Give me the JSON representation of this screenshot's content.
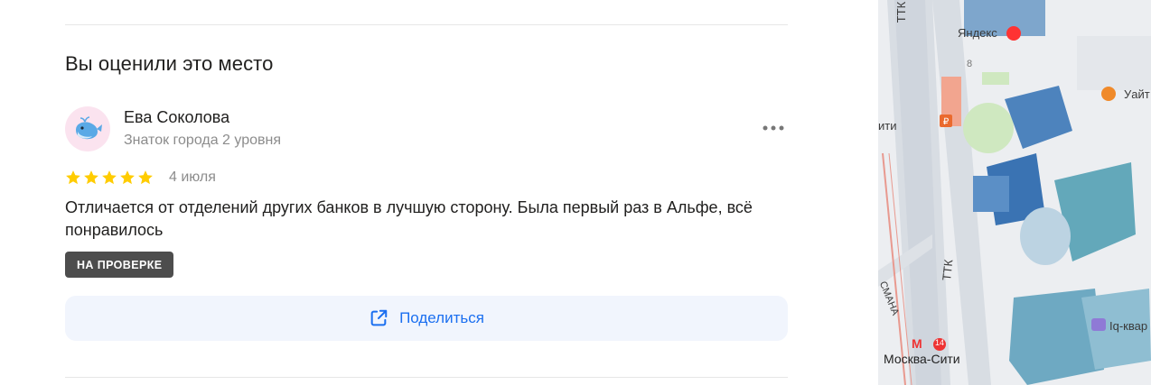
{
  "section": {
    "title": "Вы оценили это место"
  },
  "review": {
    "author_name": "Ева Соколова",
    "author_level": "Знаток города 2 уровня",
    "rating": 5,
    "date": "4 июля",
    "text": "Отличается от отделений других банков в лучшую сторону. Была первый раз в Альфе, всё понравилось",
    "status_badge": "НА ПРОВЕРКЕ"
  },
  "actions": {
    "share_label": "Поделиться"
  },
  "map": {
    "labels": {
      "yandex": "Яндекс",
      "ttk_top": "ТТК",
      "ttk_mid": "ТТК",
      "siti": "ити",
      "number_8": "8",
      "wait": "Уайт",
      "iq": "Iq-квар",
      "moscow_city": "Москва-Сити",
      "metro_line": "14",
      "street": "СМАНА"
    }
  },
  "colors": {
    "accent": "#1b6ff0",
    "star": "#ffcc00",
    "badge": "#4d4d4d",
    "share_bg": "#f1f5fd"
  }
}
